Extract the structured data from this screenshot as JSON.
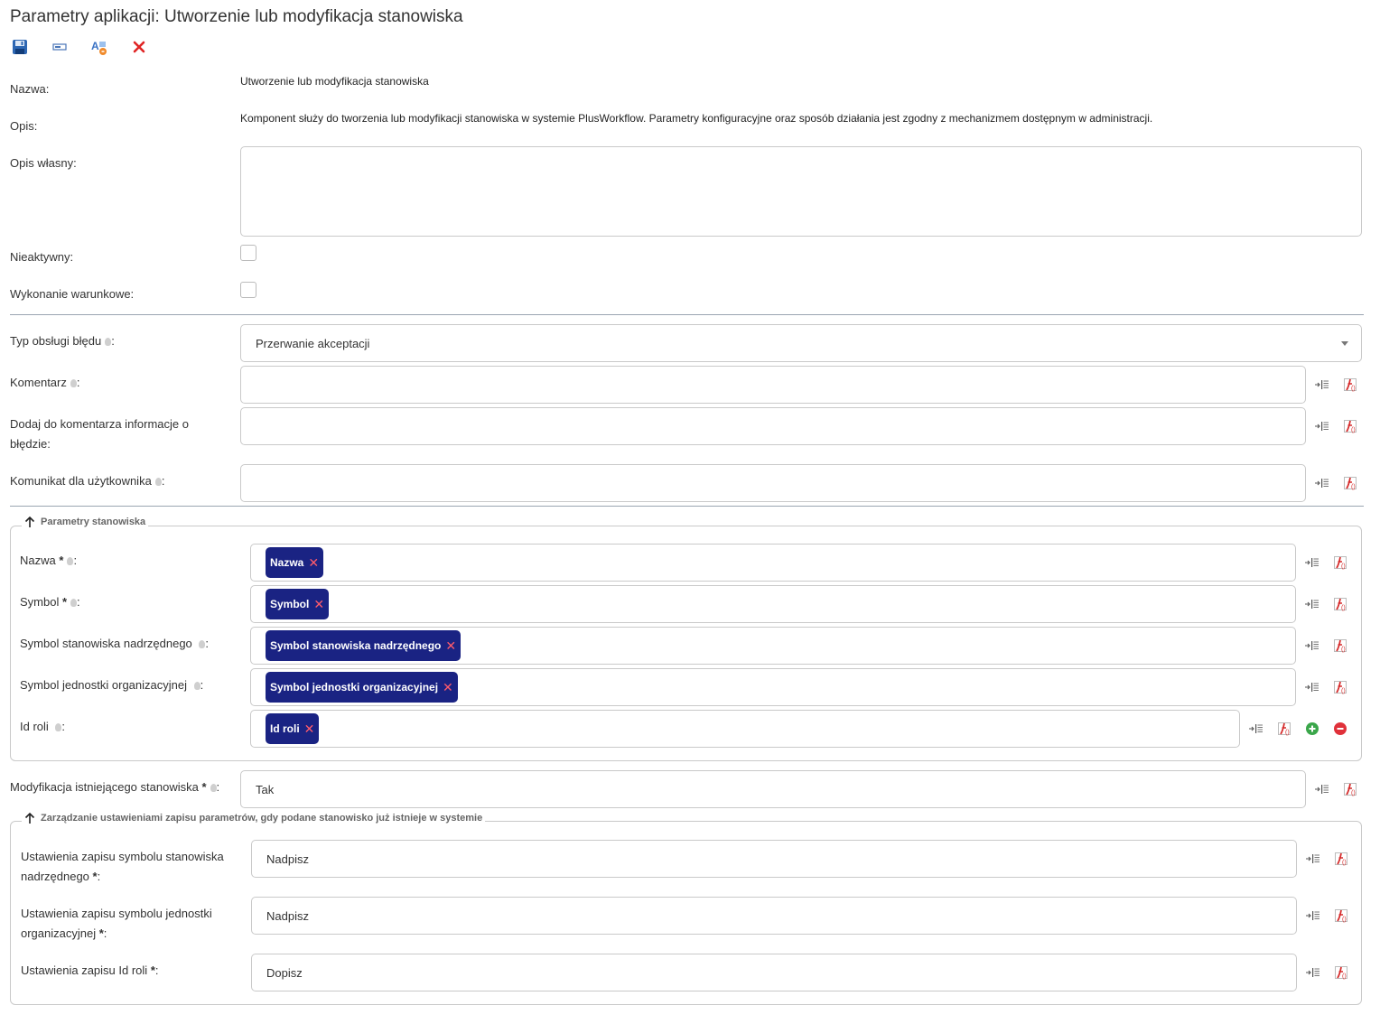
{
  "page": {
    "title": "Parametry aplikacji: Utworzenie lub modyfikacja stanowiska"
  },
  "toolbar": {
    "icons": [
      "save-icon",
      "field-icon",
      "translate-icon",
      "close-icon"
    ]
  },
  "fields": {
    "nazwa_label": "Nazwa:",
    "nazwa_value": "Utworzenie lub modyfikacja stanowiska",
    "opis_label": "Opis:",
    "opis_value": "Komponent służy do tworzenia lub modyfikacji stanowiska w systemie PlusWorkflow. Parametry konfiguracyjne oraz sposób działania jest zgodny z mechanizmem dostępnym w administracji.",
    "opis_wlasny_label": "Opis własny:",
    "opis_wlasny_value": "",
    "nieaktywny_label": "Nieaktywny:",
    "wykonanie_label": "Wykonanie warunkowe:"
  },
  "error": {
    "typ_label": "Typ obsługi błędu",
    "typ_value": "Przerwanie akceptacji",
    "komentarz_label": "Komentarz",
    "dodaj_label_1": "Dodaj do komentarza informacje o",
    "dodaj_label_2": "błędzie:",
    "komunikat_label": "Komunikat dla użytkownika"
  },
  "section1": {
    "legend": "Parametry stanowiska",
    "rows": [
      {
        "label": "Nazwa",
        "required": "*",
        "chip": "Nazwa"
      },
      {
        "label": "Symbol",
        "required": "*",
        "chip": "Symbol"
      },
      {
        "label": "Symbol stanowiska nadrzędnego",
        "required": "",
        "chip": "Symbol stanowiska nadrzędnego"
      },
      {
        "label": "Symbol jednostki organizacyjnej",
        "required": "",
        "chip": "Symbol jednostki organizacyjnej"
      },
      {
        "label": "Id roli",
        "required": "",
        "chip": "Id roli"
      }
    ]
  },
  "modyfikacja": {
    "label": "Modyfikacja istniejącego stanowiska",
    "required": "*",
    "value": "Tak"
  },
  "section2": {
    "legend": "Zarządzanie ustawieniami zapisu parametrów, gdy podane stanowisko już istnieje w systemie",
    "rows": [
      {
        "label_1": "Ustawienia zapisu symbolu stanowiska",
        "label_2": "nadrzędnego",
        "required": "*",
        "value": "Nadpisz"
      },
      {
        "label_1": "Ustawienia zapisu symbolu jednostki",
        "label_2": "organizacyjnej",
        "required": "*",
        "value": "Nadpisz"
      },
      {
        "label_1": "Ustawienia zapisu Id roli",
        "label_2": "",
        "required": "*",
        "value": "Dopisz"
      }
    ]
  },
  "colors": {
    "chip": "#1a2383",
    "chip_remove": "#ff5b6b",
    "border": "#c9c9c9",
    "divider": "#9aa5b1"
  }
}
